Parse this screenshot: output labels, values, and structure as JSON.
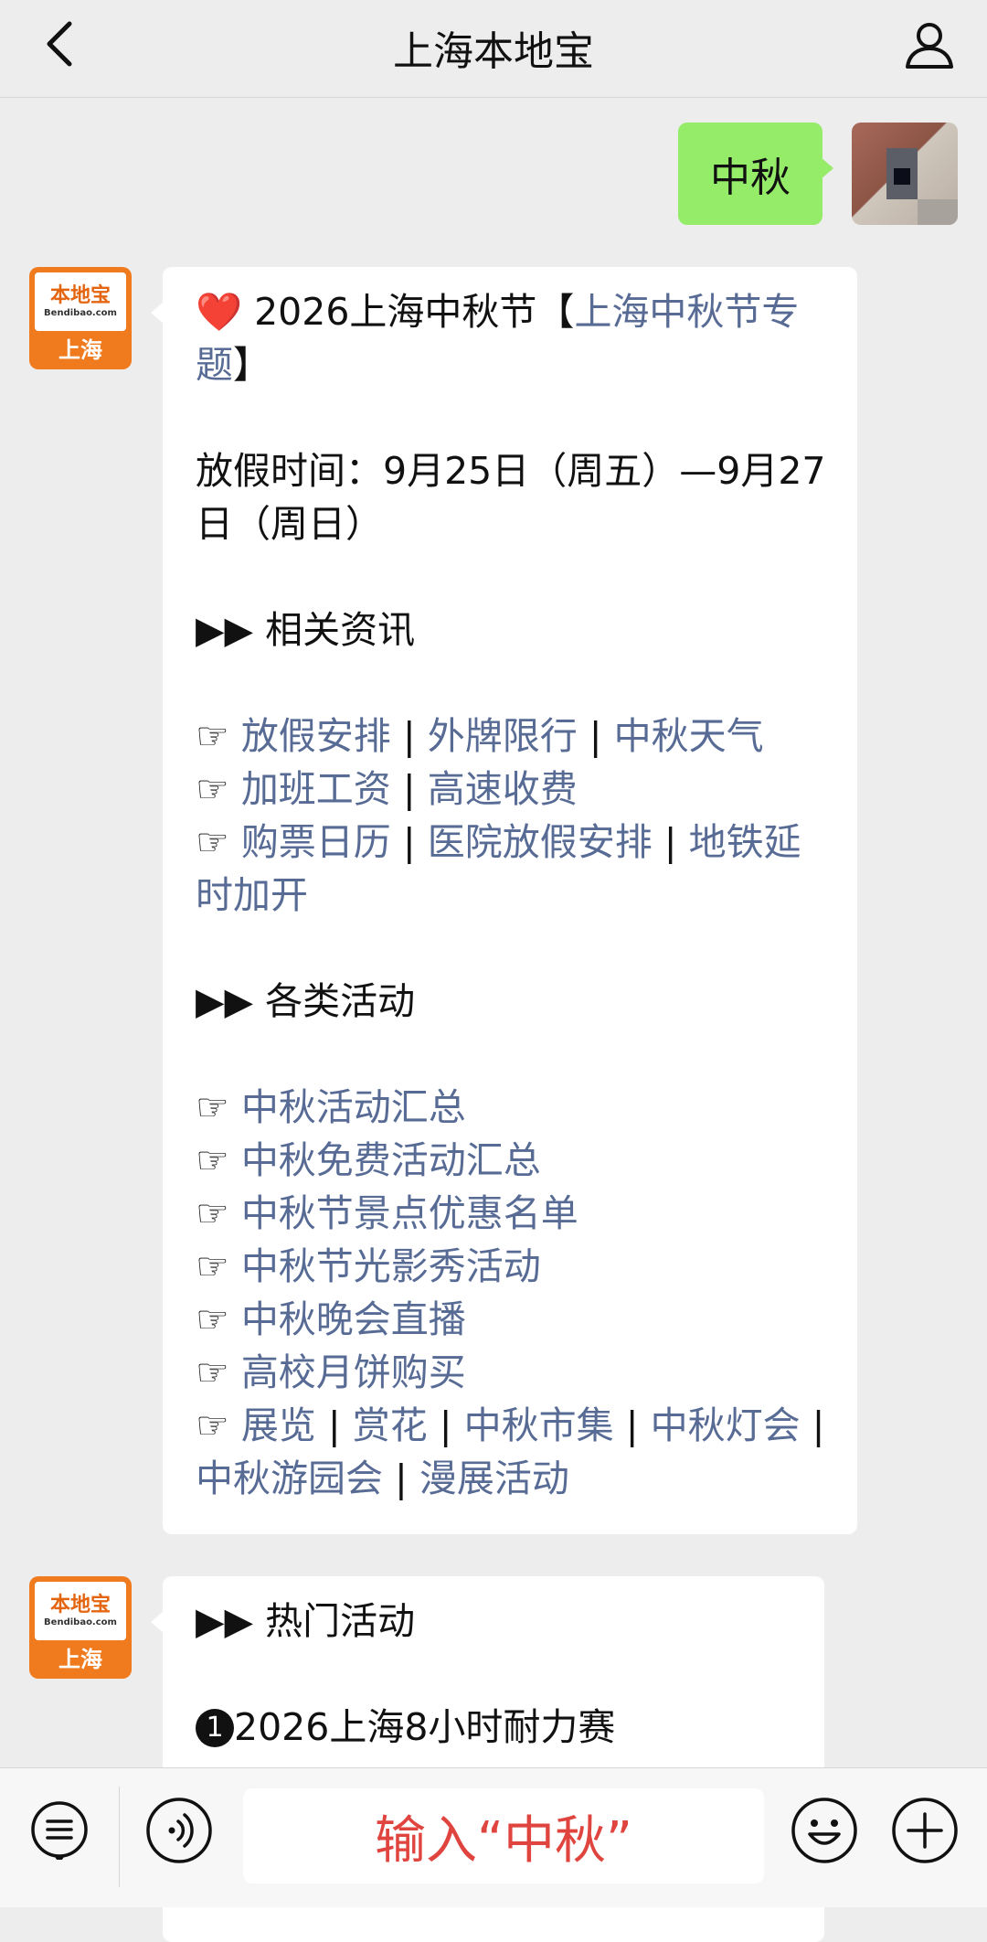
{
  "header": {
    "title": "上海本地宝"
  },
  "outgoing": {
    "text": "中秋"
  },
  "bot": {
    "brand": "本地宝",
    "domain": "Bendibao.com",
    "city": "上海"
  },
  "bubble1": {
    "heading_prefix": "❤️ 2026上海中秋节【",
    "heading_link": "上海中秋节专题",
    "heading_suffix": "】",
    "holiday": "放假时间：9月25日（周五）—9月27日（周日）",
    "section1": "▶▶ 相关资讯",
    "info_rows": [
      [
        "放假安排",
        "外牌限行",
        "中秋天气"
      ],
      [
        "加班工资",
        "高速收费"
      ],
      [
        "购票日历",
        "医院放假安排",
        "地铁延时加开"
      ]
    ],
    "section2": "▶▶ 各类活动",
    "activity_items": [
      "中秋活动汇总",
      "中秋免费活动汇总",
      "中秋节景点优惠名单",
      "中秋节光影秀活动",
      "中秋晚会直播",
      " 高校月饼购买"
    ],
    "activity_links": [
      "展览",
      "赏花",
      "中秋市集",
      "中秋灯会",
      "中秋游园会",
      "漫展活动"
    ]
  },
  "bubble2": {
    "section": "▶▶ 热门活动",
    "item_number": "1",
    "item1": "2026上海8小时耐力赛"
  },
  "toolbar": {
    "input_text": "输入“中秋”"
  },
  "pointer_glyph": "☞",
  "separator": "|",
  "colors": {
    "link": "#576b95",
    "bubble_out": "#95ec69",
    "accent_orange": "#f07b1e",
    "input_hint": "#e0443e"
  }
}
